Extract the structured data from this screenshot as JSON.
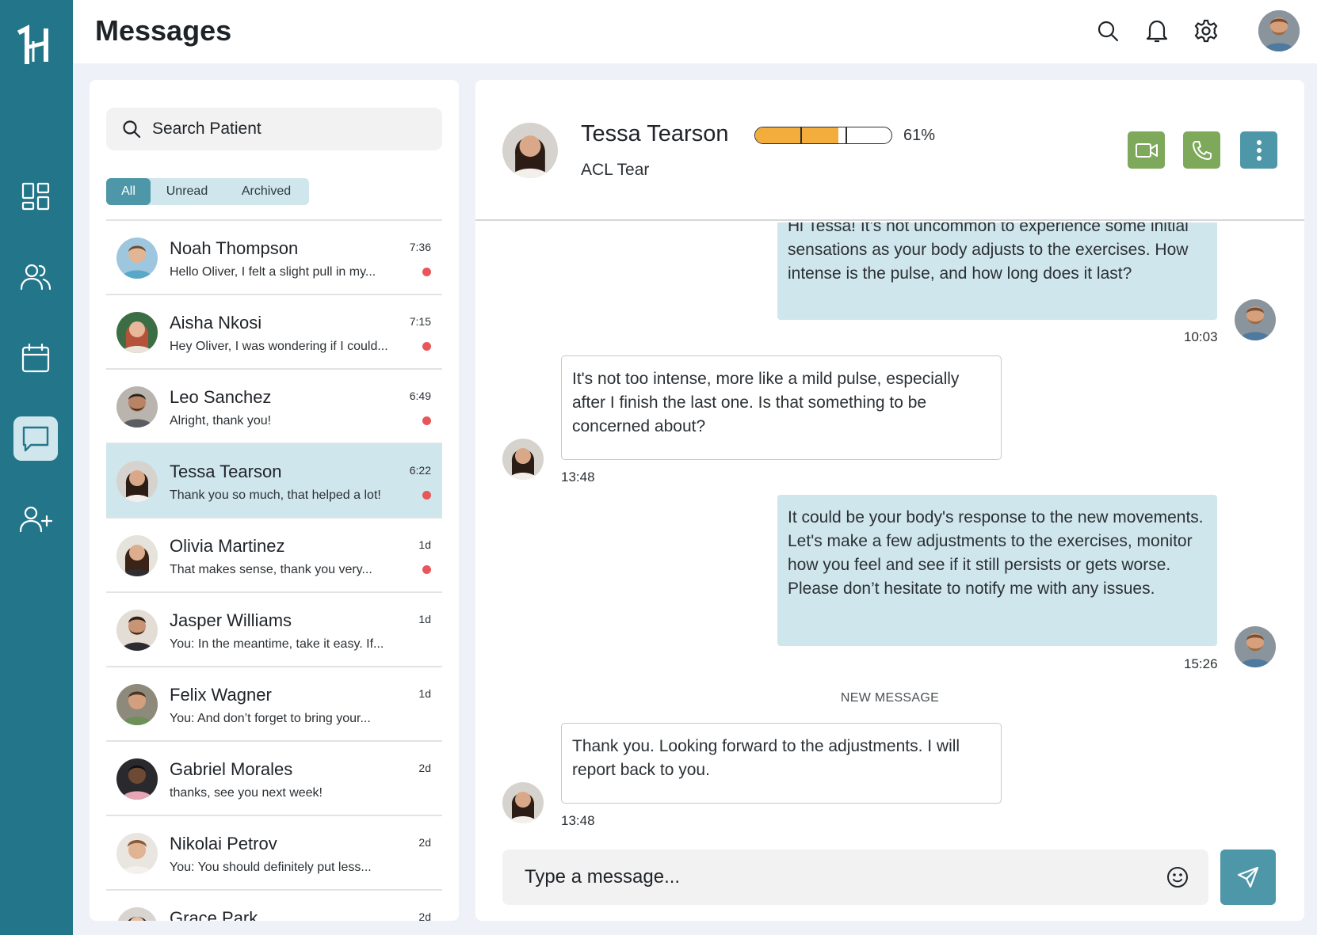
{
  "app": {
    "title": "Messages"
  },
  "colors": {
    "rail": "#23768a",
    "accent": "#4e97a8",
    "accent_light": "#cfe6ec",
    "green": "#7ea85a",
    "progress": "#f2ad3d",
    "unread_dot": "#e8565a"
  },
  "rail": {
    "logo_icon": "h-logo-icon",
    "items": [
      {
        "icon": "dashboard-grid-icon",
        "active": false
      },
      {
        "icon": "patients-icon",
        "active": false
      },
      {
        "icon": "calendar-icon",
        "active": false
      },
      {
        "icon": "chat-bubble-icon",
        "active": true
      },
      {
        "icon": "add-user-icon",
        "active": false
      }
    ]
  },
  "topbar": {
    "icons": [
      "search-icon",
      "bell-icon",
      "gear-icon",
      "avatar"
    ]
  },
  "sidebar": {
    "search_placeholder": "Search Patient",
    "filters": [
      {
        "label": "All",
        "active": true
      },
      {
        "label": "Unread",
        "active": false
      },
      {
        "label": "Archived",
        "active": false
      }
    ],
    "conversations": [
      {
        "name": "Noah Thompson",
        "preview": "Hello Oliver, I felt a slight pull in my...",
        "time": "7:36",
        "unread": true,
        "active": false
      },
      {
        "name": "Aisha Nkosi",
        "preview": "Hey Oliver, I was wondering if I could...",
        "time": "7:15",
        "unread": true,
        "active": false
      },
      {
        "name": "Leo Sanchez",
        "preview": "Alright, thank you!",
        "time": "6:49",
        "unread": true,
        "active": false
      },
      {
        "name": "Tessa Tearson",
        "preview": "Thank you so much, that helped a lot!",
        "time": "6:22",
        "unread": true,
        "active": true
      },
      {
        "name": "Olivia Martinez",
        "preview": "That makes sense, thank you very...",
        "time": "1d",
        "unread": true,
        "active": false
      },
      {
        "name": "Jasper Williams",
        "preview": "You: In the meantime, take it easy. If...",
        "time": "1d",
        "unread": false,
        "active": false
      },
      {
        "name": "Felix Wagner",
        "preview": "You: And don’t forget to bring your...",
        "time": "1d",
        "unread": false,
        "active": false
      },
      {
        "name": "Gabriel Morales",
        "preview": "thanks, see you next week!",
        "time": "2d",
        "unread": false,
        "active": false
      },
      {
        "name": "Nikolai Petrov",
        "preview": "You: You should definitely put less...",
        "time": "2d",
        "unread": false,
        "active": false
      },
      {
        "name": "Grace Park",
        "preview": "",
        "time": "2d",
        "unread": false,
        "active": false
      }
    ]
  },
  "chat": {
    "patient": {
      "name": "Tessa Tearson",
      "condition": "ACL Tear",
      "progress_percent": 61,
      "progress_label": "61%"
    },
    "actions": [
      "video-call-icon",
      "phone-icon",
      "more-vertical-icon"
    ],
    "messages": [
      {
        "from": "me",
        "text": "Hi Tessa! It’s not uncommon to experience some initial sensations as your body adjusts to the exercises. How intense is the pulse, and how long does it last?",
        "time": "10:03"
      },
      {
        "from": "patient",
        "text": "It's not too intense, more like a mild pulse, especially after I finish the last one. Is that something to be concerned about?",
        "time": "13:48"
      },
      {
        "from": "me",
        "text": "It could be your body's response to the new movements. Let's make a few adjustments to the exercises, monitor how you feel and see if it still persists or gets worse. Please don’t hesitate to notify me with any issues.",
        "time": "15:26"
      },
      {
        "from": "patient",
        "text": "Thank you. Looking forward to the adjustments. I will report back to you.",
        "time": "13:48"
      }
    ],
    "new_message_label": "NEW MESSAGE",
    "composer_placeholder": "Type a message..."
  }
}
